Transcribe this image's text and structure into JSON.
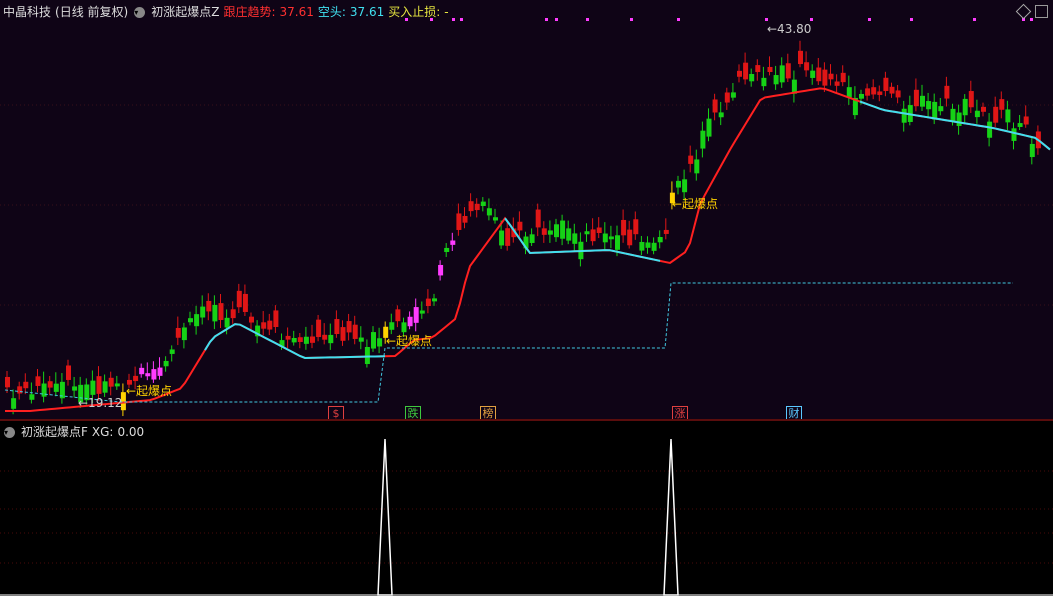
{
  "header": {
    "stock_name": "中晶科技",
    "period": "(日线 前复权)",
    "indicator_name": "初涨起爆点Z",
    "trend_label": "跟庄趋势:",
    "trend_value": "37.61",
    "short_label": "空头:",
    "short_value": "37.61",
    "buy_stop_label": "买入止损:",
    "buy_stop_value": "-"
  },
  "sub_header": {
    "indicator_name": "初涨起爆点F",
    "xg_label": "XG:",
    "xg_value": "0.00"
  },
  "annotations": {
    "high_price": "43.80",
    "low_price": "19.12",
    "signal_label": "起爆点"
  },
  "event_tags": [
    {
      "text": "$",
      "color": "#e04040"
    },
    {
      "text": "跌",
      "color": "#3ec83e"
    },
    {
      "text": "榜",
      "color": "#e0a040"
    },
    {
      "text": "涨",
      "color": "#e04040"
    },
    {
      "text": "财",
      "color": "#5ac8ff"
    }
  ],
  "colors": {
    "up": "#e01616",
    "down": "#16d216",
    "signal": "#ffd200",
    "magenta": "#ff3cff",
    "ma_red": "#ff2020",
    "ma_cyan": "#40e0f0",
    "stop_line": "#40c8e0"
  }
}
